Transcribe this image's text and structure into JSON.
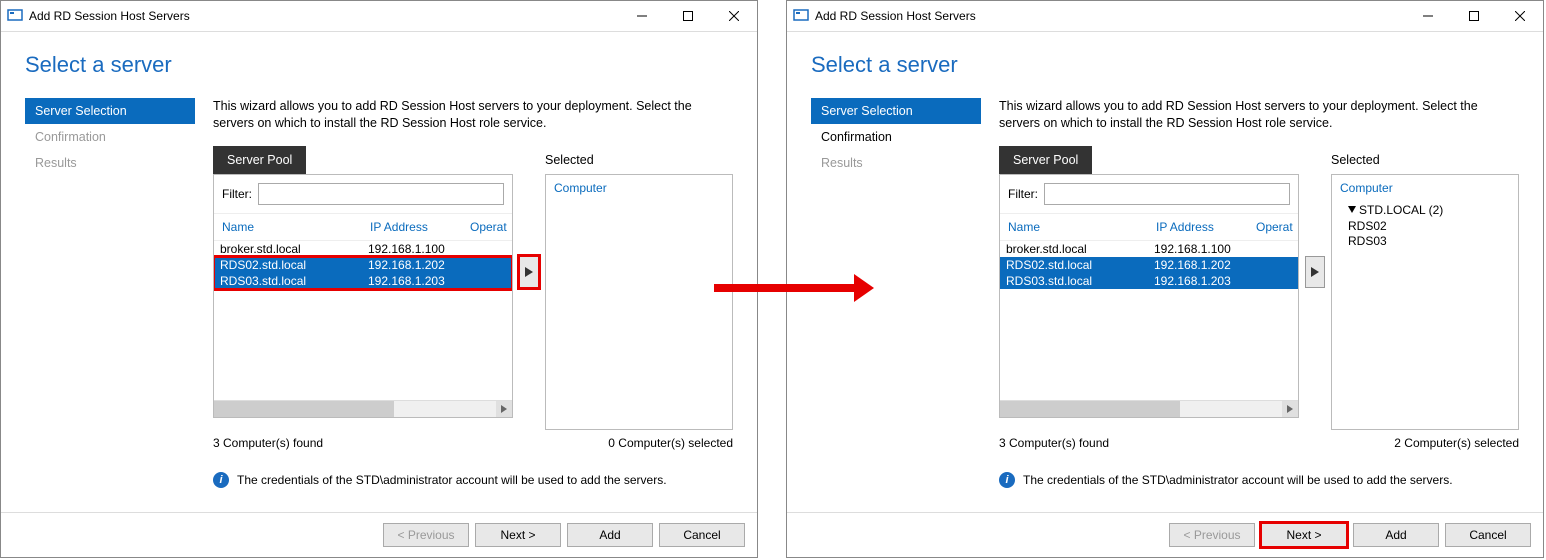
{
  "shared": {
    "window_title": "Add RD Session Host Servers",
    "heading": "Select a server",
    "nav": {
      "sel": "Server Selection",
      "conf": "Confirmation",
      "res": "Results"
    },
    "description": "This wizard allows you to add RD Session Host servers to your deployment. Select the servers on which to install the RD Session Host role service.",
    "pool_tab": "Server Pool",
    "filter_label": "Filter:",
    "filter_value": "",
    "pool_headers": {
      "name": "Name",
      "ip": "IP Address",
      "op": "Operat"
    },
    "servers": [
      {
        "name": "broker.std.local",
        "ip": "192.168.1.100",
        "selected": false
      },
      {
        "name": "RDS02.std.local",
        "ip": "192.168.1.202",
        "selected": true
      },
      {
        "name": "RDS03.std.local",
        "ip": "192.168.1.203",
        "selected": true
      }
    ],
    "selected_label": "Selected",
    "selected_header": "Computer",
    "found_text": "3 Computer(s) found",
    "info_text": "The credentials of the STD\\administrator account will be used to add the servers.",
    "buttons": {
      "prev": "< Previous",
      "next": "Next >",
      "add": "Add",
      "cancel": "Cancel"
    }
  },
  "left": {
    "selected_count": "0 Computer(s) selected",
    "selected_tree": []
  },
  "right": {
    "selected_count": "2 Computer(s) selected",
    "tree_group": "STD.LOCAL (2)",
    "tree_items": [
      "RDS02",
      "RDS03"
    ]
  }
}
